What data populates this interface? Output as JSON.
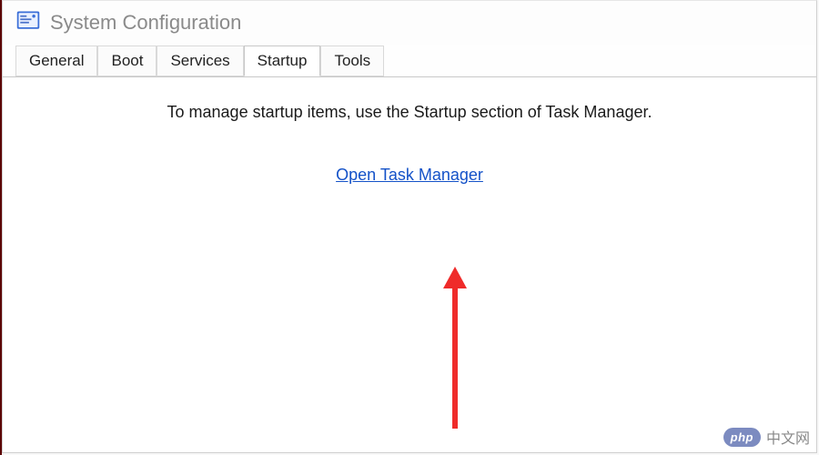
{
  "window": {
    "title": "System Configuration"
  },
  "tabs": {
    "items": [
      {
        "label": "General"
      },
      {
        "label": "Boot"
      },
      {
        "label": "Services"
      },
      {
        "label": "Startup"
      },
      {
        "label": "Tools"
      }
    ],
    "active_index": 3
  },
  "panel": {
    "message": "To manage startup items, use the Startup section of Task Manager.",
    "link_label": "Open Task Manager"
  },
  "colors": {
    "link": "#1452c8",
    "arrow": "#ef2b2a"
  },
  "watermark": {
    "badge": "php",
    "text": "中文网"
  }
}
